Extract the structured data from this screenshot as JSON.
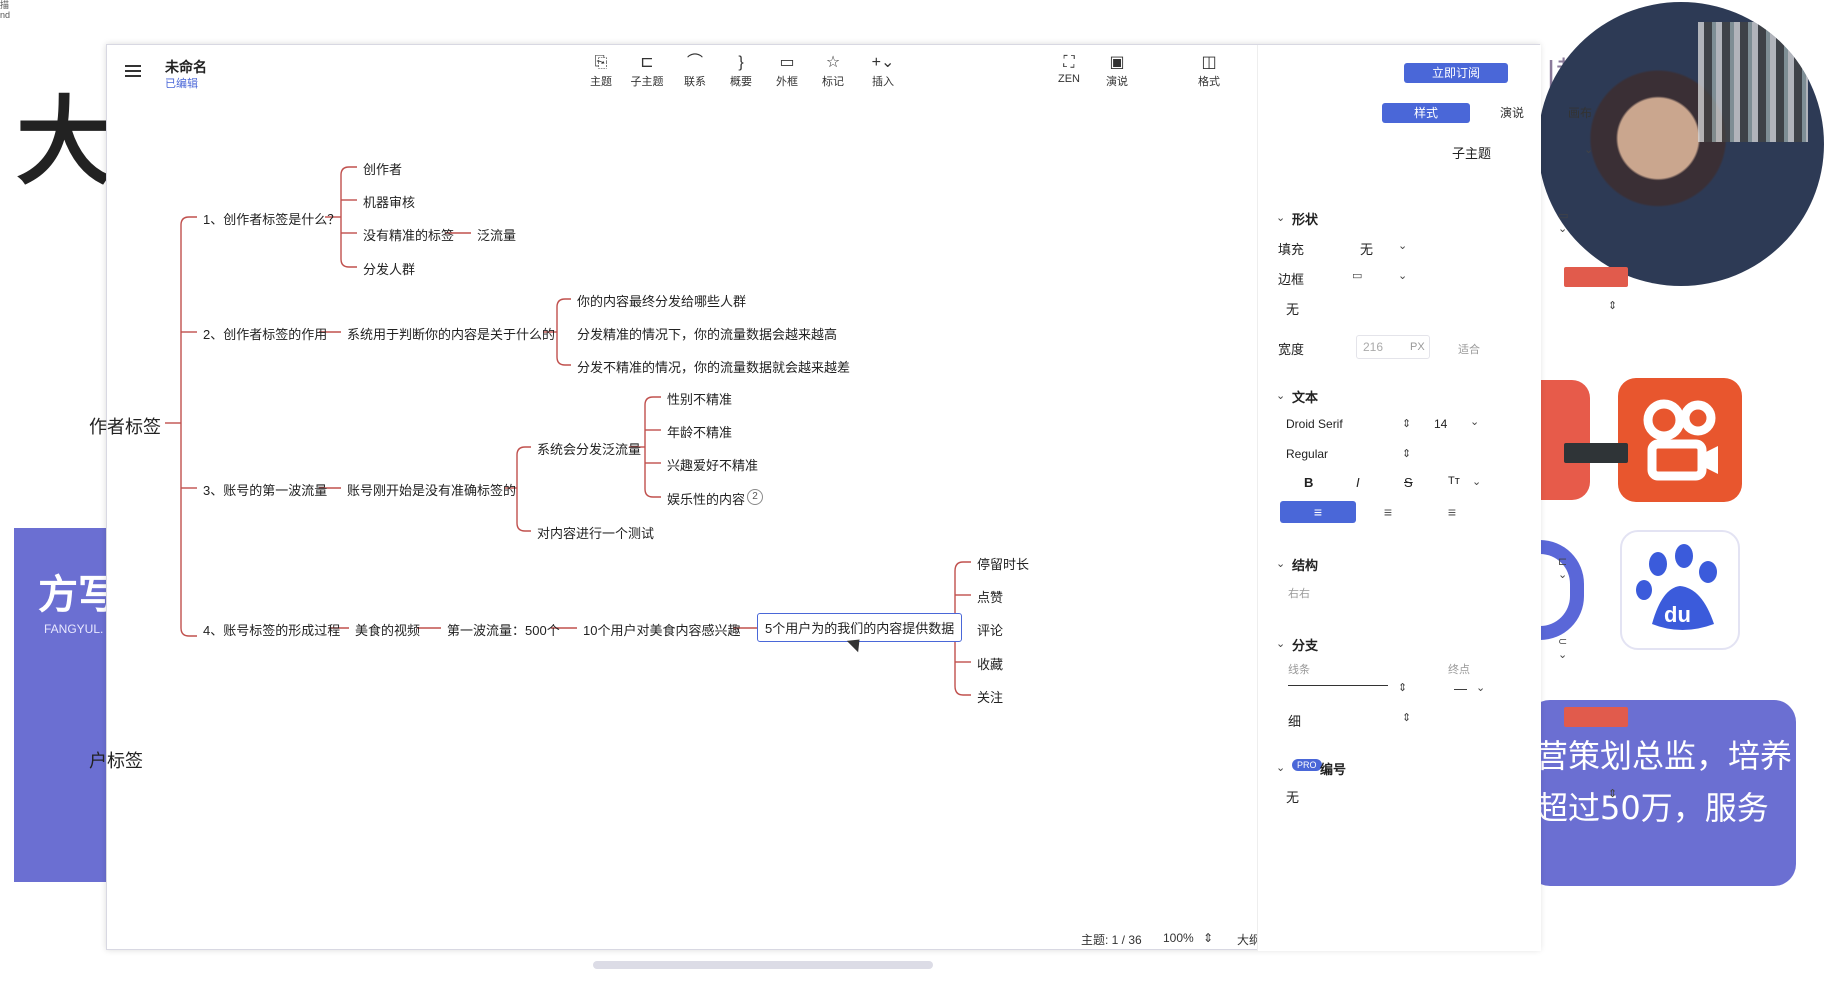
{
  "background": {
    "big_char": "大",
    "strip_text": "描\nnd",
    "card_title": "方写",
    "card_sub": "FANGYUL.",
    "purple_text": "营策划总监，培养\n超过50万，服务",
    "watermark": "|教运营",
    "root_left_label": "作者标签",
    "second_root_label": "户标签"
  },
  "window": {
    "title": "未命名",
    "status": "已编辑",
    "controls": [
      "—",
      "□",
      "✕"
    ]
  },
  "toolbar": {
    "items": [
      {
        "label": "主题",
        "icon": "topic-icon",
        "glyph": "⎘"
      },
      {
        "label": "子主题",
        "icon": "subtopic-icon",
        "glyph": "⊏"
      },
      {
        "label": "联系",
        "icon": "relationship-icon",
        "glyph": "⌒"
      },
      {
        "label": "概要",
        "icon": "summary-icon",
        "glyph": "}"
      },
      {
        "label": "外框",
        "icon": "boundary-icon",
        "glyph": "▭"
      },
      {
        "label": "标记",
        "icon": "star-icon",
        "glyph": "☆"
      },
      {
        "label": "插入",
        "icon": "plus-icon",
        "glyph": "+⌄"
      },
      {
        "label": "ZEN",
        "icon": "zen-icon",
        "glyph": "⛶"
      },
      {
        "label": "演说",
        "icon": "present-icon",
        "glyph": "▣"
      },
      {
        "label": "格式",
        "icon": "format-icon",
        "glyph": "◫"
      }
    ]
  },
  "mindmap": {
    "root": "作者标签",
    "branches": [
      {
        "label": "1、创作者标签是什么？",
        "children": [
          "创作者",
          "机器审核",
          "没有精准的标签",
          "分发人群"
        ],
        "extra": "泛流量"
      },
      {
        "label": "2、创作者标签的作用",
        "mid": "系统用于判断你的内容是关于什么的",
        "children": [
          "你的内容最终分发给哪些人群",
          "分发精准的情况下，你的流量数据会越来越高",
          "分发不精准的情况，你的流量数据就会越来越差"
        ]
      },
      {
        "label": "3、账号的第一波流量",
        "mid": "账号刚开始是没有准确标签的",
        "sub1": "系统会分发泛流量",
        "sub1_children": [
          "性别不精准",
          "年龄不精准",
          "兴趣爱好不精准",
          "娱乐性的内容"
        ],
        "sub2": "对内容进行一个测试",
        "collapsed_count": "2"
      },
      {
        "label": "4、账号标签的形成过程",
        "chain": [
          "美食的视频",
          "第一波流量：500个",
          "10个用户对美食内容感兴趣",
          "5个用户为的我们的内容提供数据"
        ],
        "children": [
          "停留时长",
          "点赞",
          "评论",
          "收藏",
          "关注"
        ]
      }
    ]
  },
  "statusbar": {
    "topic_count": "主题: 1 / 36",
    "zoom": "100%",
    "outline": "大纲"
  },
  "panel": {
    "subscribe": "立即订阅",
    "tabs": [
      "样式",
      "演说",
      "画布"
    ],
    "type_select": "子主题",
    "shape": {
      "title": "形状",
      "fill_label": "填充",
      "fill_value": "无",
      "border_label": "边框",
      "border_color": "#e15b4c",
      "border_style": "无",
      "width_label": "宽度",
      "width_value": "216",
      "width_unit": "PX",
      "width_mode": "适合"
    },
    "text": {
      "title": "文本",
      "font": "Droid Serif",
      "size": "14",
      "weight": "Regular",
      "color": "#2f3437",
      "bold": "B",
      "italic": "I",
      "strike": "S",
      "case": "Tт"
    },
    "structure": {
      "title": "结构",
      "value": "右右"
    },
    "branch": {
      "title": "分支",
      "line_label": "线条",
      "end_label": "终点",
      "end_value": "—",
      "thickness": "细",
      "color": "#e15b4c"
    },
    "numbering": {
      "badge": "PRO",
      "title": "编号",
      "value": "无"
    }
  },
  "colors": {
    "accent": "#4a67d8",
    "branch": "#c0504d",
    "purple": "#6b6fd2"
  }
}
